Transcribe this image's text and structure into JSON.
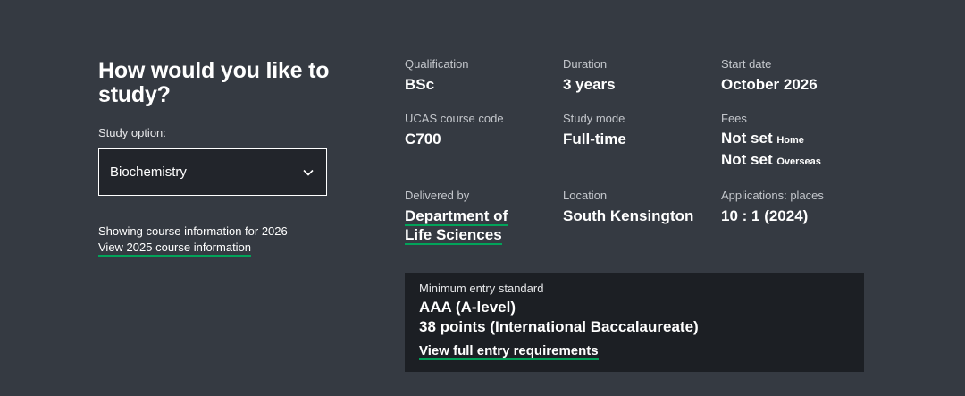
{
  "colors": {
    "background": "#353a42",
    "select_background": "#22252b",
    "entry_box_background": "#1c1f24",
    "link_underline": "#02a35a"
  },
  "study": {
    "title": "How would you like to study?",
    "option_label": "Study option:",
    "selected_option": "Biochemistry",
    "showing_text": "Showing course information for 2026",
    "other_year_link": "View 2025 course information"
  },
  "details": {
    "qualification": {
      "label": "Qualification",
      "value": "BSc"
    },
    "duration": {
      "label": "Duration",
      "value": "3 years"
    },
    "start_date": {
      "label": "Start date",
      "value": "October 2026"
    },
    "ucas_code": {
      "label": "UCAS course code",
      "value": "C700"
    },
    "study_mode": {
      "label": "Study mode",
      "value": "Full-time"
    },
    "fees": {
      "label": "Fees",
      "home_value": "Not set",
      "home_suffix": "Home",
      "overseas_value": "Not set",
      "overseas_suffix": "Overseas"
    },
    "delivered_by": {
      "label": "Delivered by",
      "line1": "Department of",
      "line2": "Life Sciences"
    },
    "location": {
      "label": "Location",
      "value": "South Kensington"
    },
    "applications": {
      "label": "Applications: places",
      "value": "10 : 1 (2024)"
    }
  },
  "entry": {
    "label": "Minimum entry standard",
    "line1": "AAA (A-level)",
    "line2": "38 points (International Baccalaureate)",
    "link": "View full entry requirements"
  },
  "icons": {
    "select_chevron": "chevron-down-icon"
  }
}
